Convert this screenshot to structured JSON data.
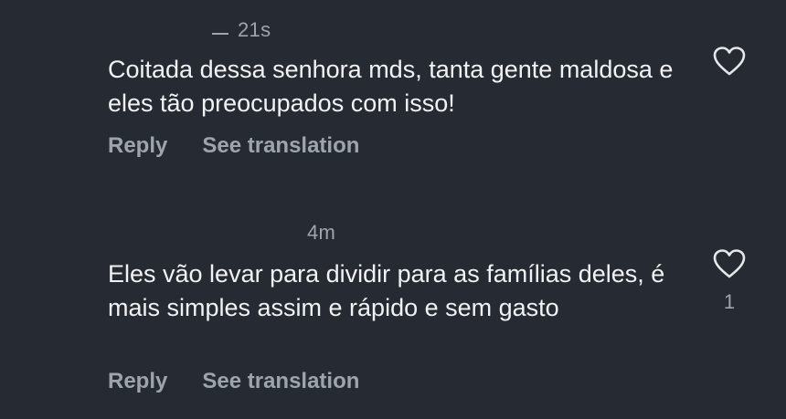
{
  "comments": [
    {
      "timestamp": "21s",
      "text": "Coitada dessa senhora mds, tanta gente maldosa e eles tão preocupados com isso!",
      "like_count": "",
      "actions": {
        "reply": "Reply",
        "translate": "See translation"
      }
    },
    {
      "timestamp": "4m",
      "text": "Eles vão levar para dividir para as famílias deles, é mais simples assim e rápido e sem gasto",
      "like_count": "1",
      "actions": {
        "reply": "Reply",
        "translate": "See translation"
      }
    }
  ],
  "icons": {
    "like": "heart-outline-icon"
  },
  "colors": {
    "background": "#262a33",
    "text": "#f1f2f4",
    "muted": "#9ea4ad"
  }
}
